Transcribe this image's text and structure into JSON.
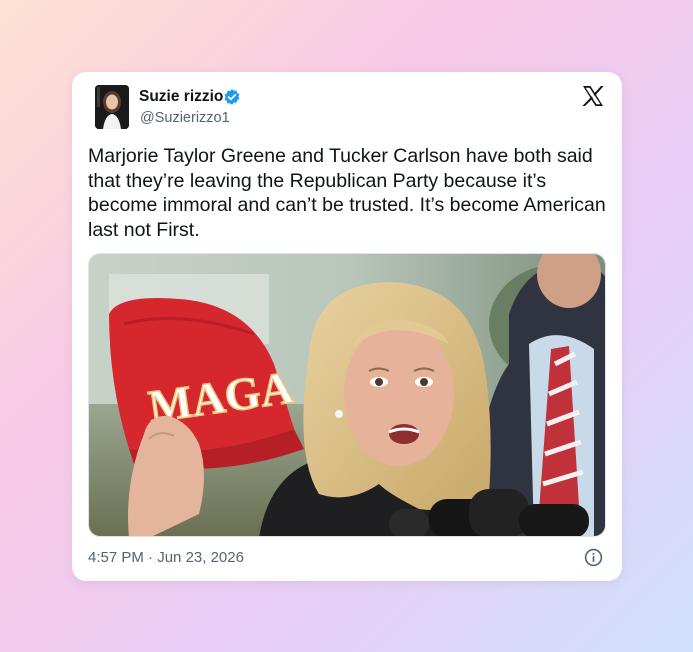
{
  "tweet": {
    "author_name": "Suzie rizzio",
    "author_handle": "@Suzierizzo1",
    "text": "Marjorie Taylor Greene and Tucker Carlson have both said that they’re leaving the Republican Party because it’s become immoral and can’t be trusted. It’s become American last not First.",
    "media": {
      "hat_text": "MAGA"
    },
    "time": "4:57 PM",
    "separator": "·",
    "date": "Jun 23, 2026"
  },
  "icons": {
    "verified": "verified-badge-icon",
    "platform": "x-logo-icon",
    "info": "info-icon"
  },
  "colors": {
    "accent": "#1d9bf0",
    "text": "#0f1419",
    "secondary": "#536471"
  }
}
